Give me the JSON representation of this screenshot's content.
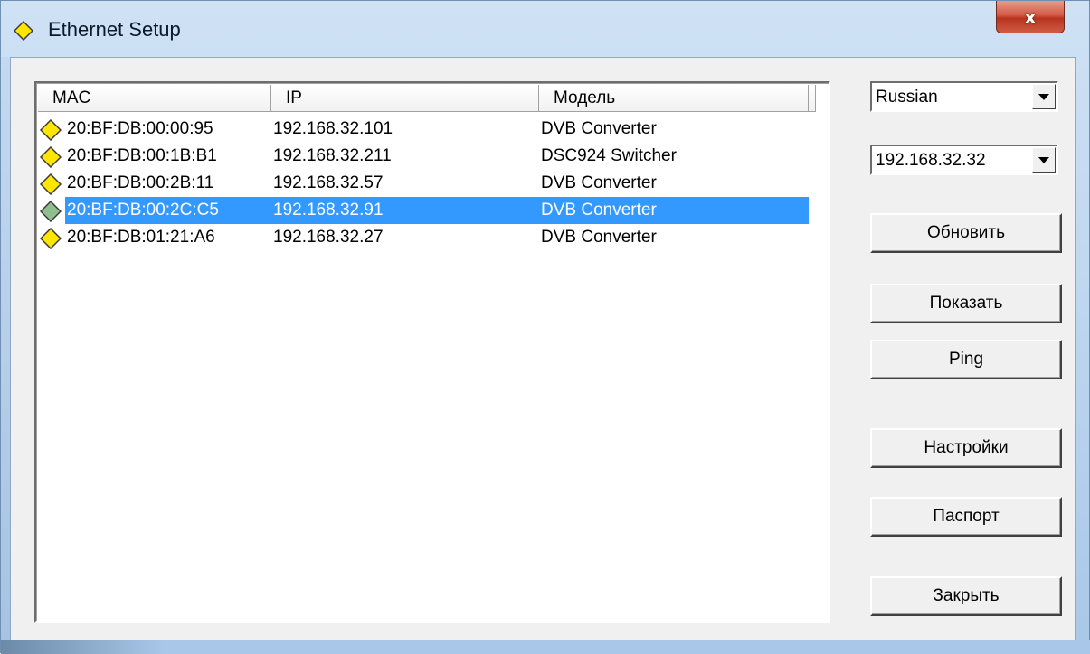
{
  "window": {
    "title": "Ethernet Setup",
    "close_label": "x"
  },
  "list": {
    "columns": [
      "MAC",
      "IP",
      "Модель"
    ],
    "rows": [
      {
        "mac": "20:BF:DB:00:00:95",
        "ip": "192.168.32.101",
        "model": "DVB Converter",
        "selected": false
      },
      {
        "mac": "20:BF:DB:00:1B:B1",
        "ip": "192.168.32.211",
        "model": "DSC924 Switcher",
        "selected": false
      },
      {
        "mac": "20:BF:DB:00:2B:11",
        "ip": "192.168.32.57",
        "model": "DVB Converter",
        "selected": false
      },
      {
        "mac": "20:BF:DB:00:2C:C5",
        "ip": "192.168.32.91",
        "model": "DVB Converter",
        "selected": true
      },
      {
        "mac": "20:BF:DB:01:21:A6",
        "ip": "192.168.32.27",
        "model": "DVB Converter",
        "selected": false
      }
    ]
  },
  "controls": {
    "language": "Russian",
    "interface_ip": "192.168.32.32",
    "refresh_label": "Обновить",
    "show_label": "Показать",
    "ping_label": "Ping",
    "settings_label": "Настройки",
    "passport_label": "Паспорт",
    "close_label": "Закрыть"
  },
  "colors": {
    "selection": "#3399ff",
    "device_icon": "#ffe600",
    "device_icon_selected": "#8fbf8f"
  },
  "icons": {
    "title": "yellow-diamond-icon",
    "device": "yellow-diamond-icon",
    "device_selected": "green-diamond-icon",
    "dropdown": "chevron-down-icon"
  }
}
